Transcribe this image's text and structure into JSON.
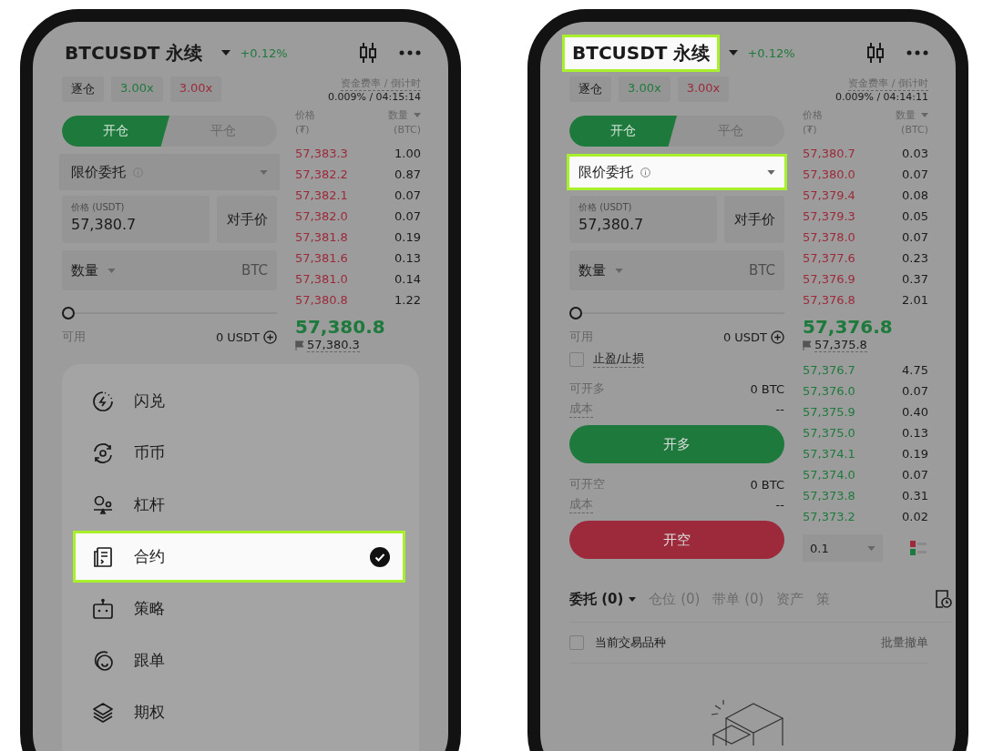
{
  "phones": [
    {
      "header": {
        "symbol": "BTCUSDT 永续",
        "highlighted": false,
        "change": "+0.12%"
      },
      "margin_mode": "逐仓",
      "long_leverage": "3.00x",
      "short_leverage": "3.00x",
      "funding": {
        "label": "资金费率 / 倒计时",
        "value": "0.009% / 04:15:14"
      },
      "tabs": [
        {
          "label": "开仓",
          "selected": true
        },
        {
          "label": "平仓",
          "selected": false
        }
      ],
      "order_type": {
        "label": "限价委托",
        "highlighted": false
      },
      "price_field": {
        "label": "价格 (USDT)",
        "value": "57,380.7"
      },
      "counter_price": "对手价",
      "amount_field": {
        "label": "数量",
        "unit": "BTC"
      },
      "slider": {
        "level": 0
      },
      "available": {
        "label": "可用",
        "value": "0 USDT"
      },
      "orderbook": {
        "price_header": "价格",
        "price_unit": "(₮)",
        "qty_header": "数量",
        "qty_unit": "(BTC)",
        "asks": [
          {
            "price": "57,383.3",
            "qty": "1.00"
          },
          {
            "price": "57,382.2",
            "qty": "0.87"
          },
          {
            "price": "57,382.1",
            "qty": "0.07"
          },
          {
            "price": "57,382.0",
            "qty": "0.07"
          },
          {
            "price": "57,381.8",
            "qty": "0.19"
          },
          {
            "price": "57,381.6",
            "qty": "0.13"
          },
          {
            "price": "57,381.0",
            "qty": "0.14"
          },
          {
            "price": "57,380.8",
            "qty": "1.22"
          }
        ],
        "last_price": "57,380.8",
        "mark_price": "57,380.3"
      },
      "sheet": {
        "items": [
          {
            "kind": "flash",
            "label": "闪兑",
            "selected": false
          },
          {
            "kind": "spot",
            "label": "币币",
            "selected": false
          },
          {
            "kind": "margin",
            "label": "杠杆",
            "selected": false
          },
          {
            "kind": "contract",
            "label": "合约",
            "selected": true
          },
          {
            "kind": "bot",
            "label": "策略",
            "selected": false
          },
          {
            "kind": "copy",
            "label": "跟单",
            "selected": false
          },
          {
            "kind": "options",
            "label": "期权",
            "selected": false
          }
        ]
      }
    },
    {
      "header": {
        "symbol": "BTCUSDT 永续",
        "highlighted": true,
        "change": "+0.12%"
      },
      "margin_mode": "逐仓",
      "long_leverage": "3.00x",
      "short_leverage": "3.00x",
      "funding": {
        "label": "资金费率 / 倒计时",
        "value": "0.009% / 04:14:11"
      },
      "tabs": [
        {
          "label": "开仓",
          "selected": true
        },
        {
          "label": "平仓",
          "selected": false
        }
      ],
      "order_type": {
        "label": "限价委托",
        "highlighted": true
      },
      "price_field": {
        "label": "价格 (USDT)",
        "value": "57,380.7"
      },
      "counter_price": "对手价",
      "amount_field": {
        "label": "数量",
        "unit": "BTC"
      },
      "slider": {
        "level": 0
      },
      "available": {
        "label": "可用",
        "value": "0 USDT"
      },
      "tp_sl": {
        "label": "止盈/止损",
        "checked": false
      },
      "long": {
        "max_label": "可开多",
        "max_value": "0 BTC",
        "cost_label": "成本",
        "cost_value": "--",
        "button": "开多"
      },
      "short": {
        "max_label": "可开空",
        "max_value": "0 BTC",
        "cost_label": "成本",
        "cost_value": "--",
        "button": "开空"
      },
      "orderbook": {
        "price_header": "价格",
        "price_unit": "(₮)",
        "qty_header": "数量",
        "qty_unit": "(BTC)",
        "asks": [
          {
            "price": "57,380.7",
            "qty": "0.03"
          },
          {
            "price": "57,380.0",
            "qty": "0.07"
          },
          {
            "price": "57,379.4",
            "qty": "0.08"
          },
          {
            "price": "57,379.3",
            "qty": "0.05"
          },
          {
            "price": "57,378.0",
            "qty": "0.07"
          },
          {
            "price": "57,377.6",
            "qty": "0.23"
          },
          {
            "price": "57,376.9",
            "qty": "0.37"
          },
          {
            "price": "57,376.8",
            "qty": "2.01"
          }
        ],
        "last_price": "57,376.8",
        "mark_price": "57,375.8",
        "bids": [
          {
            "price": "57,376.7",
            "qty": "4.75"
          },
          {
            "price": "57,376.0",
            "qty": "0.07"
          },
          {
            "price": "57,375.9",
            "qty": "0.40"
          },
          {
            "price": "57,375.0",
            "qty": "0.13"
          },
          {
            "price": "57,374.1",
            "qty": "0.19"
          },
          {
            "price": "57,374.0",
            "qty": "0.07"
          },
          {
            "price": "57,373.8",
            "qty": "0.31"
          },
          {
            "price": "57,373.2",
            "qty": "0.02"
          }
        ],
        "precision": "0.1"
      },
      "orders": {
        "tabs": [
          {
            "label": "委托 (0)",
            "selected": true,
            "dropdown": true
          },
          {
            "label": "仓位 (0)",
            "selected": false,
            "dropdown": false
          },
          {
            "label": "带单 (0)",
            "selected": false,
            "dropdown": false
          },
          {
            "label": "资产",
            "selected": false,
            "dropdown": false
          },
          {
            "label": "策",
            "selected": false,
            "dropdown": false
          }
        ],
        "filter": {
          "label": "当前交易品种",
          "checked": false
        },
        "cancel_all": "批量撤单"
      }
    }
  ]
}
